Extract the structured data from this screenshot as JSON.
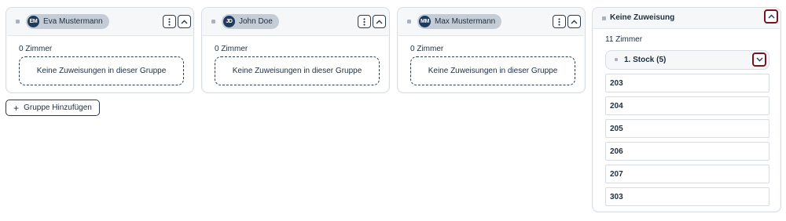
{
  "groups": [
    {
      "user": {
        "initials": "EM",
        "name": "Eva Mustermann"
      },
      "room_count": "0 Zimmer",
      "empty_text": "Keine Zuweisungen in dieser Gruppe"
    },
    {
      "user": {
        "initials": "JD",
        "name": "John Doe"
      },
      "room_count": "0 Zimmer",
      "empty_text": "Keine Zuweisungen in dieser Gruppe"
    },
    {
      "user": {
        "initials": "MM",
        "name": "Max Mustermann"
      },
      "room_count": "0 Zimmer",
      "empty_text": "Keine Zuweisungen in dieser Gruppe"
    }
  ],
  "add_group_label": "Gruppe Hinzufügen",
  "unassigned": {
    "title": "Keine Zuweisung",
    "room_count": "11 Zimmer",
    "floor": {
      "label": "1. Stock (5)"
    },
    "rooms": [
      "203",
      "204",
      "205",
      "206",
      "207",
      "303"
    ]
  },
  "colors": {
    "accent": "#1f3a5f",
    "highlight_frame": "#7a1420",
    "chip": "#c4ccd6"
  },
  "icons": [
    "drag-handle-icon",
    "more-vertical-icon",
    "chevron-up-icon",
    "chevron-down-icon",
    "plus-icon"
  ]
}
